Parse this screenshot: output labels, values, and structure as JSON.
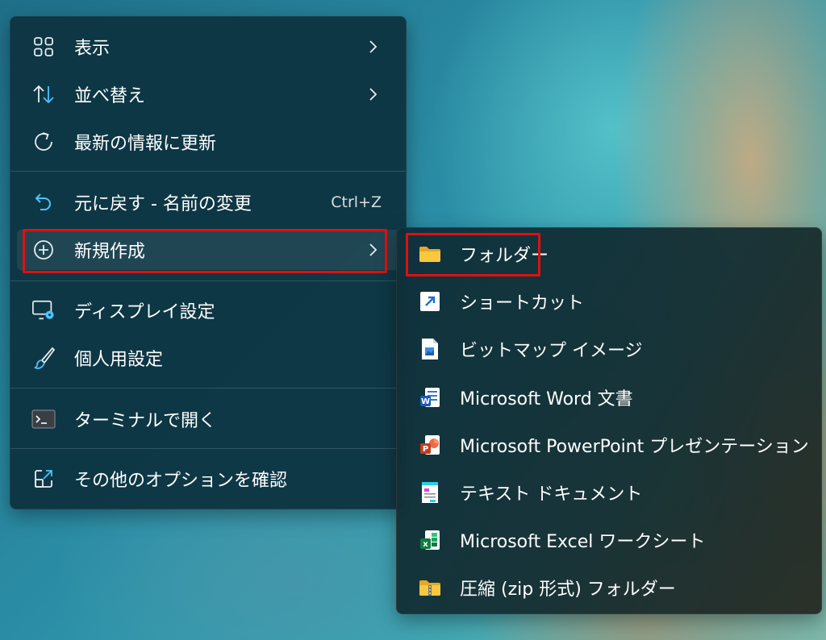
{
  "context_menu": {
    "items": [
      {
        "label": "表示",
        "icon": "grid-icon",
        "has_submenu": true
      },
      {
        "label": "並べ替え",
        "icon": "sort-arrows-icon",
        "has_submenu": true
      },
      {
        "label": "最新の情報に更新",
        "icon": "refresh-icon",
        "has_submenu": false
      },
      {
        "label": "元に戻す - 名前の変更",
        "icon": "undo-icon",
        "shortcut": "Ctrl+Z"
      },
      {
        "label": "新規作成",
        "icon": "add-circle-icon",
        "has_submenu": true,
        "highlighted": true
      },
      {
        "label": "ディスプレイ設定",
        "icon": "display-settings-icon"
      },
      {
        "label": "個人用設定",
        "icon": "brush-icon"
      },
      {
        "label": "ターミナルで開く",
        "icon": "terminal-icon"
      },
      {
        "label": "その他のオプションを確認",
        "icon": "open-external-icon"
      }
    ]
  },
  "new_submenu": {
    "items": [
      {
        "label": "フォルダー",
        "icon": "folder-icon",
        "highlighted": true
      },
      {
        "label": "ショートカット",
        "icon": "shortcut-icon"
      },
      {
        "label": "ビットマップ イメージ",
        "icon": "bitmap-file-icon"
      },
      {
        "label": "Microsoft Word 文書",
        "icon": "word-icon"
      },
      {
        "label": "Microsoft PowerPoint プレゼンテーション",
        "icon": "powerpoint-icon"
      },
      {
        "label": "テキスト ドキュメント",
        "icon": "text-document-icon"
      },
      {
        "label": "Microsoft Excel ワークシート",
        "icon": "excel-icon"
      },
      {
        "label": "圧縮 (zip 形式) フォルダー",
        "icon": "zip-folder-icon"
      }
    ]
  },
  "colors": {
    "menu_background": "#0e3442",
    "highlight_border": "#e01010",
    "accent_blue": "#4cc2ff",
    "folder_yellow": "#f8c940"
  }
}
